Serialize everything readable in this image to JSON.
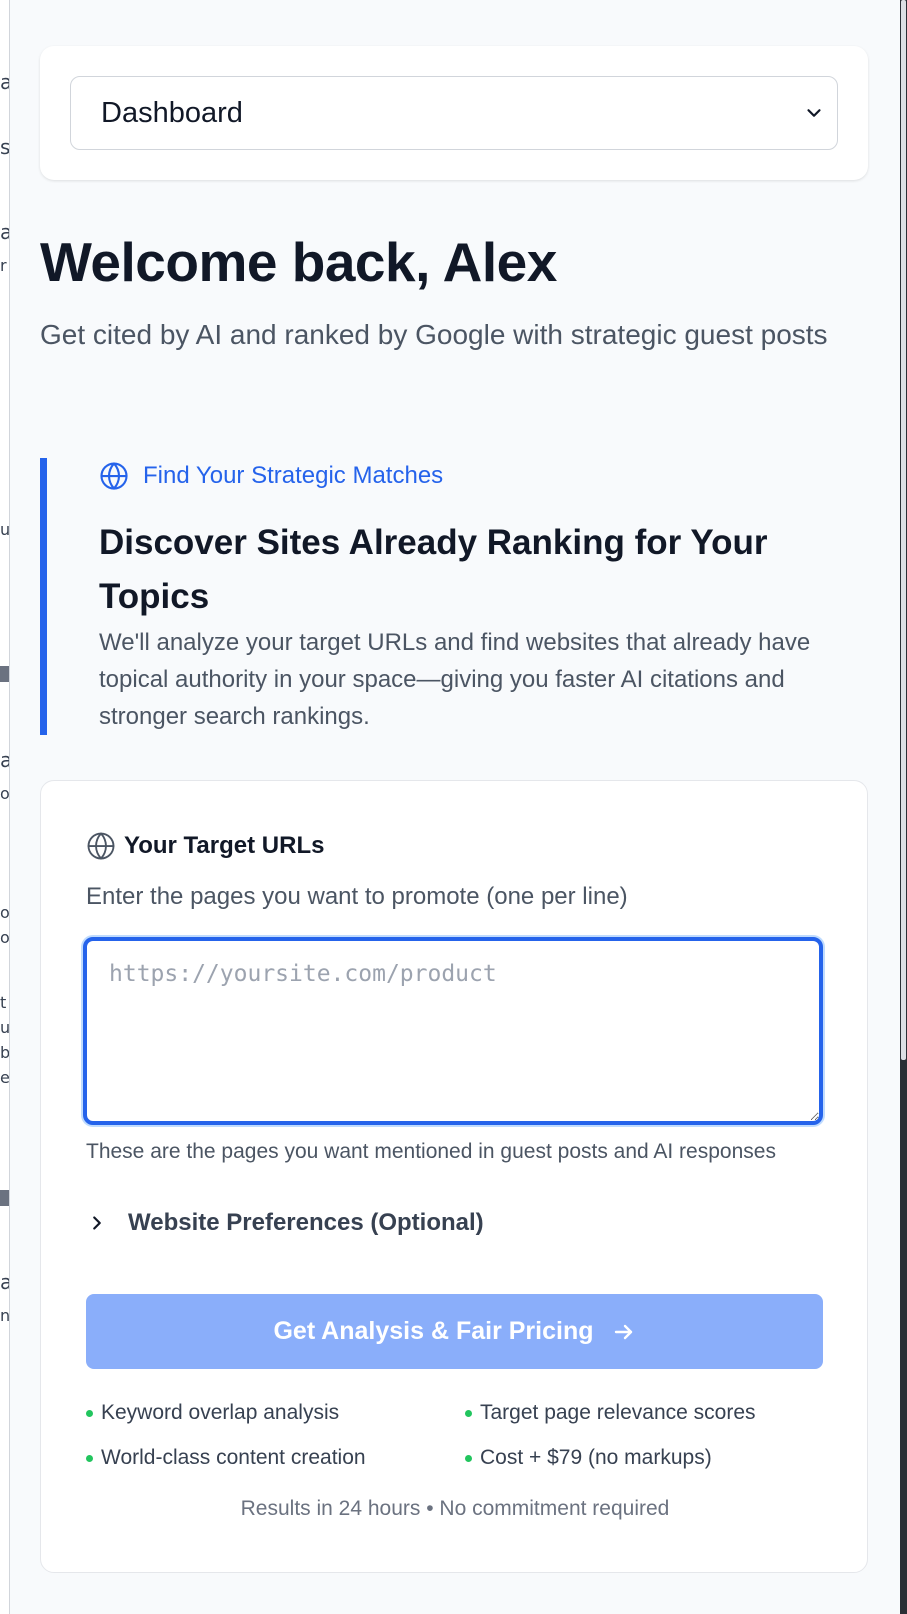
{
  "background_window": {
    "fragments": [
      "a",
      "s",
      "a",
      "r",
      "u",
      "a",
      "o",
      "o",
      "o",
      "t",
      "u",
      "b",
      "e",
      "a",
      "n"
    ]
  },
  "nav": {
    "selected": "Dashboard",
    "chevron_icon": "chevron-down-icon"
  },
  "header": {
    "title": "Welcome back, Alex",
    "subtitle": "Get cited by AI and ranked by Google with strategic guest posts"
  },
  "feature": {
    "icon": "globe-icon",
    "kicker": "Find Your Strategic Matches",
    "title": "Discover Sites Already Ranking for Your Topics",
    "description": "We'll analyze your target URLs and find websites that already have topical authority in your space—giving you faster AI citations and stronger search rankings.",
    "accent_color": "#2563eb"
  },
  "form": {
    "label_icon": "globe-icon",
    "label": "Your Target URLs",
    "hint": "Enter the pages you want to promote (one per line)",
    "urls_value": "",
    "urls_placeholder": "https://yoursite.com/product",
    "help": "These are the pages you want mentioned in guest posts and AI responses",
    "preferences_label": "Website Preferences (Optional)",
    "submit_label": "Get Analysis & Fair Pricing",
    "submit_color": "#8aaefa",
    "benefits": [
      "Keyword overlap analysis",
      "Target page relevance scores",
      "World-class content creation",
      "Cost + $79 (no markups)"
    ],
    "benefit_dot_color": "#22c55e",
    "footer_note": "Results in 24 hours • No commitment required"
  }
}
